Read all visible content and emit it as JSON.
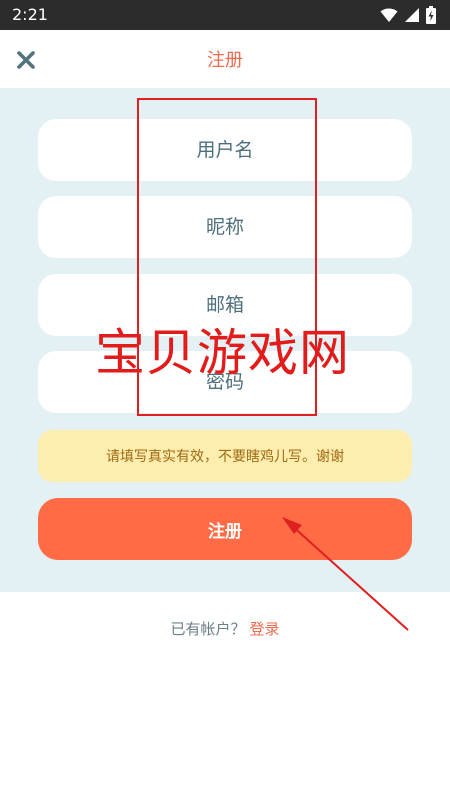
{
  "status_bar": {
    "time": "2:21"
  },
  "header": {
    "title": "注册"
  },
  "form": {
    "username_placeholder": "用户名",
    "nickname_placeholder": "昵称",
    "email_placeholder": "邮箱",
    "password_placeholder": "密码",
    "notice": "请填写真实有效，不要瞎鸡儿写。谢谢",
    "submit_label": "注册"
  },
  "footer": {
    "has_account_text": "已有帐户？",
    "login_link": "登录"
  },
  "watermark": {
    "text": "宝贝游戏网"
  },
  "colors": {
    "accent": "#ff6b45",
    "title": "#f26b4e",
    "form_bg": "#e3f0f4",
    "notice_bg": "#fdeeb0",
    "annotation_red": "#e02020"
  }
}
